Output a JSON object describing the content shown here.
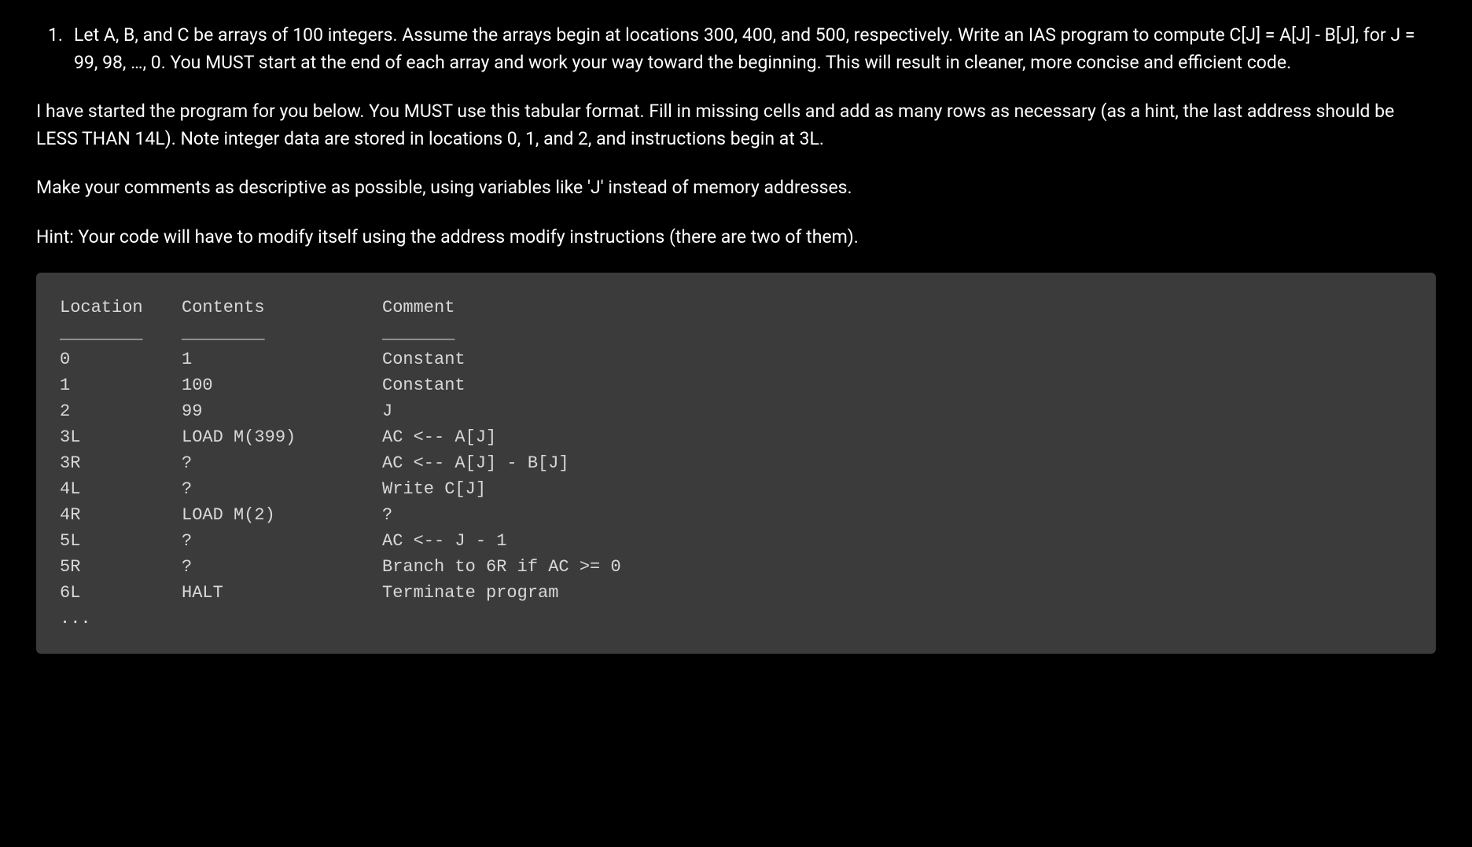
{
  "question": {
    "number": "1.",
    "text": "Let A, B, and C be arrays of 100 integers. Assume the arrays begin at locations 300, 400, and 500, respectively. Write an IAS program to compute C[J] = A[J] - B[J], for J = 99, 98, …, 0. You MUST start at the end of each array and work your way toward the beginning. This will result in cleaner, more concise and efficient code."
  },
  "paragraphs": [
    "I have started the program for you below. You MUST use this tabular format. Fill in missing cells and add as many rows as necessary (as a hint, the last address should be LESS THAN 14L). Note integer data are stored in locations 0, 1, and 2, and instructions begin at 3L.",
    "Make your comments as descriptive as possible, using variables like 'J' instead of memory addresses.",
    "Hint: Your code will have to modify itself using the address modify instructions (there are two of them)."
  ],
  "table": {
    "headers": {
      "location": "Location",
      "contents": "Contents",
      "comment": "Comment"
    },
    "dashes": {
      "location": "________",
      "contents": "________",
      "comment": "_______"
    },
    "rows": [
      {
        "location": "0",
        "contents": "1",
        "comment": "Constant"
      },
      {
        "location": "1",
        "contents": "100",
        "comment": "Constant"
      },
      {
        "location": "2",
        "contents": "99",
        "comment": "J"
      },
      {
        "location": "3L",
        "contents": "LOAD M(399)",
        "comment": "AC <-- A[J]"
      },
      {
        "location": "3R",
        "contents": "?",
        "comment": "AC <-- A[J] - B[J]"
      },
      {
        "location": "4L",
        "contents": "?",
        "comment": "Write C[J]"
      },
      {
        "location": "4R",
        "contents": "LOAD M(2)",
        "comment": "?"
      },
      {
        "location": "5L",
        "contents": "?",
        "comment": "AC <-- J - 1"
      },
      {
        "location": "5R",
        "contents": "?",
        "comment": "Branch to 6R if AC >= 0"
      },
      {
        "location": "6L",
        "contents": "HALT",
        "comment": "Terminate program"
      },
      {
        "location": "...",
        "contents": "",
        "comment": ""
      }
    ]
  }
}
